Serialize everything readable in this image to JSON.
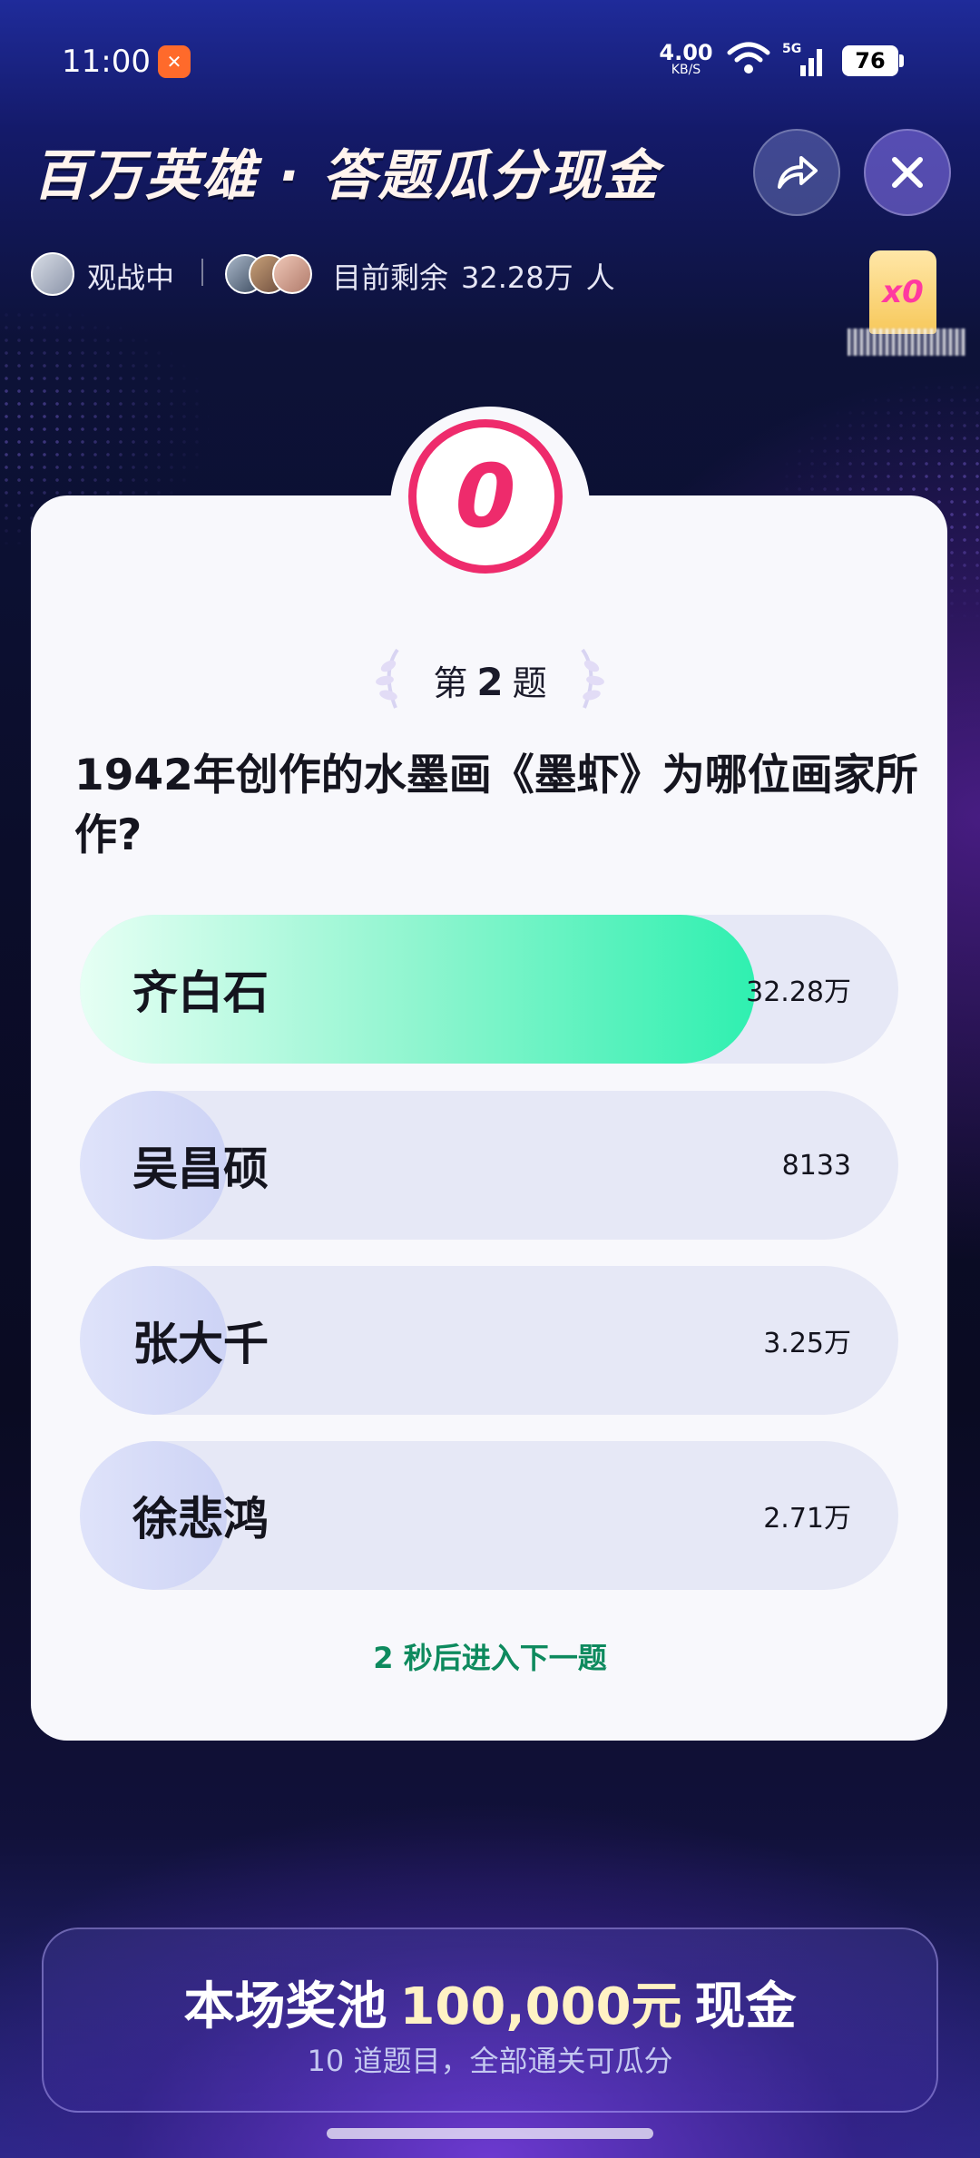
{
  "status_bar": {
    "time": "11:00",
    "net_speed_value": "4.00",
    "net_speed_unit": "KB/S",
    "battery": "76",
    "icons": [
      "app-notification-icon",
      "wifi-icon",
      "5g-signal-icon",
      "battery-icon"
    ]
  },
  "header": {
    "title": "百万英雄 · 答题瓜分现金",
    "share_icon": "share-icon",
    "close_icon": "close-icon"
  },
  "audience": {
    "watch_label": "观战中",
    "remaining_prefix": "目前剩余",
    "remaining_count": "32.28万",
    "remaining_suffix": "人"
  },
  "multiplier": {
    "label": "x0"
  },
  "timer": {
    "value": "0"
  },
  "question": {
    "prefix": "第",
    "number": "2",
    "suffix": "题",
    "text": "1942年创作的水墨画《墨虾》为哪位画家所作?"
  },
  "options": [
    {
      "label": "齐白石",
      "count": "32.28万",
      "fill_fraction": 0.825,
      "correct": true
    },
    {
      "label": "吴昌硕",
      "count": "8133",
      "fill_fraction": 0.18,
      "correct": false
    },
    {
      "label": "张大千",
      "count": "3.25万",
      "fill_fraction": 0.18,
      "correct": false
    },
    {
      "label": "徐悲鸿",
      "count": "2.71万",
      "fill_fraction": 0.18,
      "correct": false
    }
  ],
  "next_hint": {
    "seconds": "2",
    "text": "秒后进入下一题"
  },
  "prize": {
    "prefix": "本场奖池",
    "amount": "100,000元",
    "suffix": "现金",
    "subtitle": "10 道题目，全部通关可瓜分"
  },
  "colors": {
    "accent_pink": "#ee2b6c",
    "correct_green": "#2ff0b0",
    "hint_green": "#0e8a5e",
    "prize_gold": "#fff2c4"
  }
}
